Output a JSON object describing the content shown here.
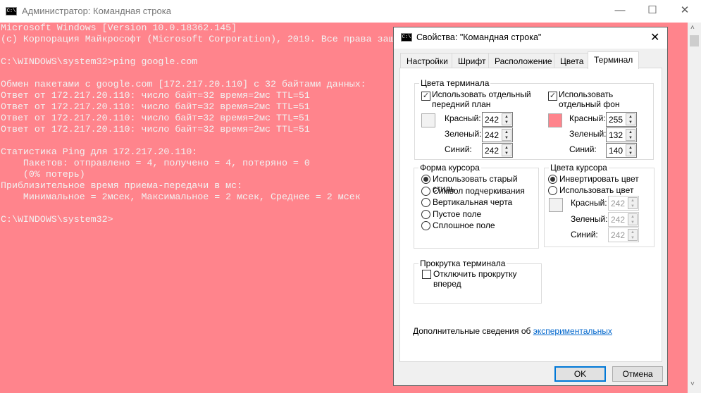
{
  "window": {
    "title": "Администратор: Командная строка",
    "icon": "cmd-icon",
    "controls": {
      "minimize": "—",
      "maximize": "☐",
      "close": "✕"
    }
  },
  "console": {
    "background": "#FF848C",
    "foreground": "#F2F2F2",
    "lines": [
      "Microsoft Windows [Version 10.0.18362.145]",
      "(c) Корпорация Майкрософт (Microsoft Corporation), 2019. Все права защищены.",
      "",
      "C:\\WINDOWS\\system32>ping google.com",
      "",
      "Обмен пакетами с google.com [172.217.20.110] с 32 байтами данных:",
      "Ответ от 172.217.20.110: число байт=32 время=2мс TTL=51",
      "Ответ от 172.217.20.110: число байт=32 время=2мс TTL=51",
      "Ответ от 172.217.20.110: число байт=32 время=2мс TTL=51",
      "Ответ от 172.217.20.110: число байт=32 время=2мс TTL=51",
      "",
      "Статистика Ping для 172.217.20.110:",
      "    Пакетов: отправлено = 4, получено = 4, потеряно = 0",
      "    (0% потерь)",
      "Приблизительное время приема-передачи в мс:",
      "    Минимальное = 2мсек, Максимальное = 2 мсек, Среднее = 2 мсек",
      "",
      "C:\\WINDOWS\\system32>"
    ]
  },
  "dialog": {
    "title": "Свойства: \"Командная строка\"",
    "close": "✕",
    "tabs": [
      "Настройки",
      "Шрифт",
      "Расположение",
      "Цвета",
      "Терминал"
    ],
    "active_tab": "Терминал",
    "terminal_colors": {
      "label": "Цвета терминала",
      "fg_checkbox": {
        "label1": "Использовать отдельный",
        "label2": "передний план",
        "checked": true
      },
      "bg_checkbox": {
        "label1": "Использовать",
        "label2": "отдельный фон",
        "checked": true
      },
      "fg": {
        "red_label": "Красный:",
        "green_label": "Зеленый:",
        "blue_label": "Синий:",
        "red": "242",
        "green": "242",
        "blue": "242",
        "swatch": "#F2F2F2"
      },
      "bg": {
        "red_label": "Красный:",
        "green_label": "Зеленый:",
        "blue_label": "Синий:",
        "red": "255",
        "green": "132",
        "blue": "140",
        "swatch": "#FF848C"
      }
    },
    "cursor_shape": {
      "label": "Форма курсора",
      "options": [
        "Использовать старый стиль",
        "Символ подчеркивания",
        "Вертикальная черта",
        "Пустое поле",
        "Сплошное поле"
      ],
      "selected": 0
    },
    "cursor_colors": {
      "label": "Цвета курсора",
      "options": [
        "Инвертировать цвет",
        "Использовать цвет"
      ],
      "selected": 0,
      "red_label": "Красный:",
      "green_label": "Зеленый:",
      "blue_label": "Синий:",
      "red": "242",
      "green": "242",
      "blue": "242"
    },
    "scrolling": {
      "label": "Прокрутка терминала",
      "checkbox": "Отключить прокрутку вперед",
      "checked": false
    },
    "info_text": "Дополнительные сведения об",
    "info_link": "экспериментальных",
    "ok": "OK",
    "cancel": "Отмена"
  }
}
